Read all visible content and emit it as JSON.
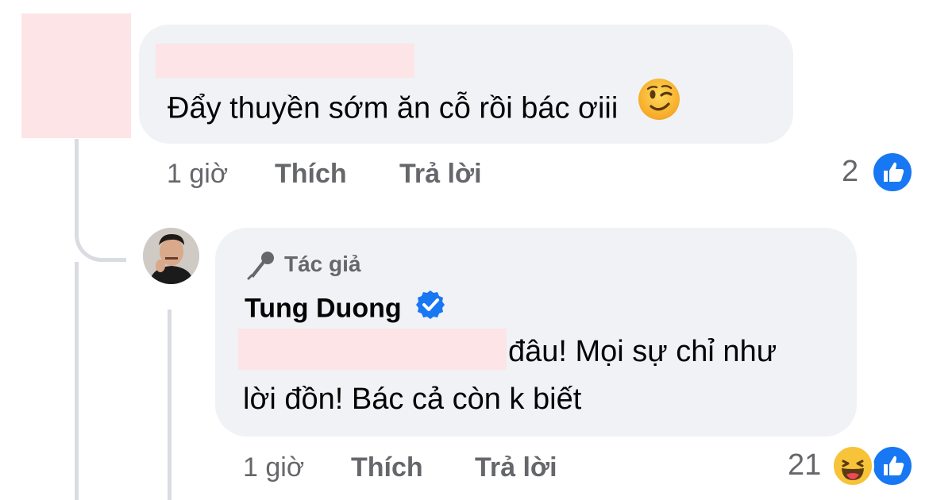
{
  "comment_1": {
    "text": "Đẩy thuyền sớm ăn cỗ rồi bác ơiii",
    "emoji": "wink-emoji",
    "time": "1 giờ",
    "like_label": "Thích",
    "reply_label": "Trả lời",
    "reaction_count": "2",
    "reaction_icons": [
      "like-icon"
    ]
  },
  "reply_1": {
    "badge_label": "Tác giả",
    "badge_icon": "microphone-icon",
    "author": "Tung Duong",
    "verified": true,
    "text_line1": "đâu! Mọi sự chỉ như",
    "text_line2": "lời đồn! Bác cả còn k biết",
    "time": "1 giờ",
    "like_label": "Thích",
    "reply_label": "Trả lời",
    "reaction_count": "21",
    "reaction_icons": [
      "haha-icon",
      "like-icon"
    ]
  },
  "colors": {
    "bubble": "#f0f2f5",
    "text": "#050505",
    "secondary_text": "#65676b",
    "like_blue": "#1877f2",
    "verified_blue": "#1877f2",
    "redaction": "#fde4e6"
  }
}
